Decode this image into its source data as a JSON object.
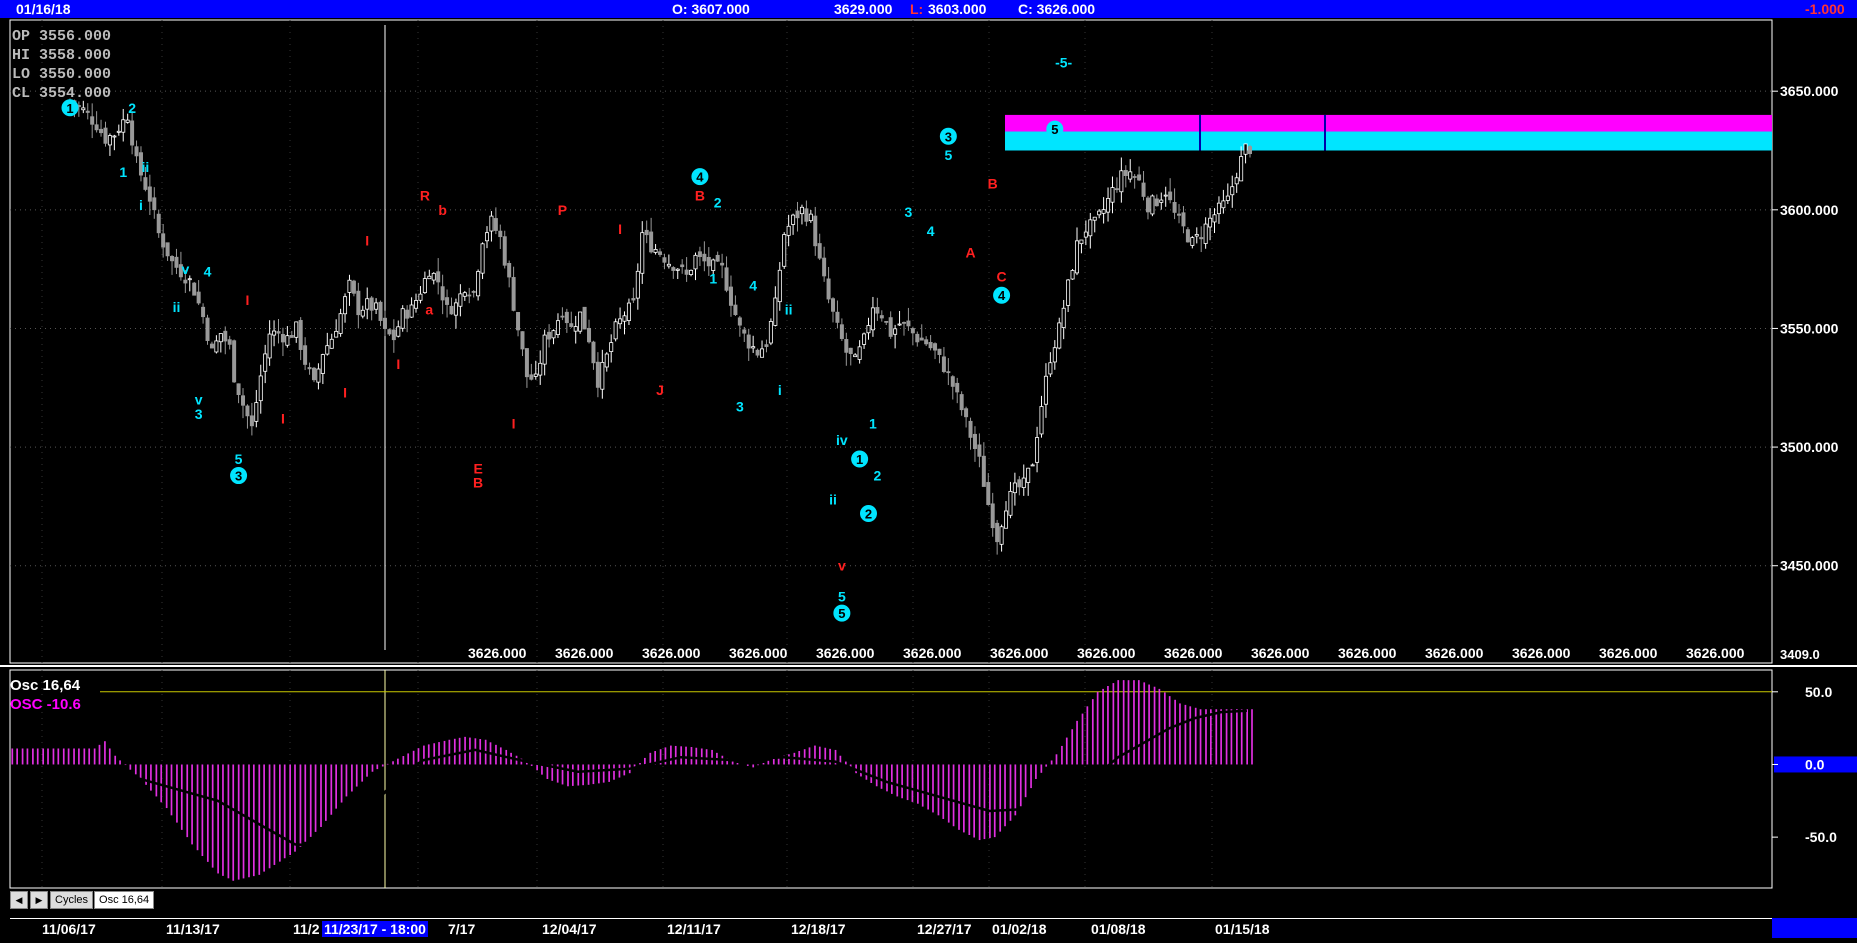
{
  "header": {
    "date": "01/16/18",
    "open": "O: 3607.000",
    "high": "3629.000",
    "low": "L: 3603.000",
    "close": "C: 3626.000",
    "change": "-1.000"
  },
  "info_panel": {
    "op": "OP  3556.000",
    "hi": "HI   3558.000",
    "lo": "LO  3550.000",
    "cl": "CL  3554.000"
  },
  "osc_panel": {
    "title": "Osc 16,64",
    "value": "OSC -10.6"
  },
  "tabs": [
    "Cycles",
    "Osc 16,64"
  ],
  "colors": {
    "up_candle": "#ffffff",
    "down_candle": "#999999",
    "cyan": "#00e5ff",
    "red": "#ff2020",
    "magenta": "#ff00ff",
    "histogram": "#e030e0",
    "header_bg": "#0000ff"
  },
  "chart_data": [
    {
      "type": "candlestick",
      "y_axis_ticks": [
        "3650.000",
        "3600.000",
        "3550.000",
        "3500.000",
        "3450.000"
      ],
      "y_axis_values": [
        3650,
        3600,
        3550,
        3500,
        3450
      ],
      "ylim": [
        3409,
        3680
      ],
      "axis_bottom_label": "3409.0",
      "price_line_labels": [
        "3626.000",
        "3626.000",
        "3626.000",
        "3626.000",
        "3626.000",
        "3626.000",
        "3626.000",
        "3626.000",
        "3626.000",
        "3626.000",
        "3626.000",
        "3626.000",
        "3626.000",
        "3626.000",
        "3626.000"
      ],
      "x_dates": [
        "11/06/17",
        "11/13/17",
        "11/2",
        "11/23/17 - 18:00",
        "7/17",
        "12/04/17",
        "12/11/17",
        "12/18/17",
        "12/27/17",
        "01/02/18",
        "01/08/18",
        "01/15/18"
      ],
      "close_path": [
        [
          0,
          3646
        ],
        [
          3,
          3642
        ],
        [
          6,
          3636
        ],
        [
          8,
          3630
        ],
        [
          10,
          3632
        ],
        [
          13,
          3640
        ],
        [
          15,
          3620
        ],
        [
          18,
          3605
        ],
        [
          20,
          3590
        ],
        [
          23,
          3578
        ],
        [
          25,
          3574
        ],
        [
          27,
          3570
        ],
        [
          28,
          3566
        ],
        [
          30,
          3555
        ],
        [
          32,
          3540
        ],
        [
          34,
          3548
        ],
        [
          36,
          3542
        ],
        [
          37,
          3530
        ],
        [
          39,
          3518
        ],
        [
          41,
          3508
        ],
        [
          43,
          3530
        ],
        [
          45,
          3548
        ],
        [
          47,
          3548
        ],
        [
          49,
          3546
        ],
        [
          51,
          3550
        ],
        [
          53,
          3536
        ],
        [
          55,
          3526
        ],
        [
          57,
          3540
        ],
        [
          59,
          3546
        ],
        [
          61,
          3556
        ],
        [
          63,
          3568
        ],
        [
          65,
          3558
        ],
        [
          67,
          3560
        ],
        [
          69,
          3558
        ],
        [
          71,
          3548
        ],
        [
          73,
          3546
        ],
        [
          75,
          3556
        ],
        [
          77,
          3558
        ],
        [
          79,
          3566
        ],
        [
          81,
          3575
        ],
        [
          83,
          3570
        ],
        [
          85,
          3558
        ],
        [
          87,
          3560
        ],
        [
          89,
          3568
        ],
        [
          91,
          3565
        ],
        [
          93,
          3588
        ],
        [
          95,
          3595
        ],
        [
          97,
          3588
        ],
        [
          99,
          3570
        ],
        [
          101,
          3550
        ],
        [
          103,
          3530
        ],
        [
          105,
          3528
        ],
        [
          107,
          3545
        ],
        [
          109,
          3550
        ],
        [
          111,
          3558
        ],
        [
          113,
          3550
        ],
        [
          115,
          3556
        ],
        [
          117,
          3546
        ],
        [
          119,
          3528
        ],
        [
          121,
          3538
        ],
        [
          123,
          3550
        ],
        [
          125,
          3556
        ],
        [
          127,
          3560
        ],
        [
          129,
          3590
        ],
        [
          131,
          3585
        ],
        [
          133,
          3582
        ],
        [
          135,
          3578
        ],
        [
          137,
          3576
        ],
        [
          139,
          3572
        ],
        [
          141,
          3580
        ],
        [
          143,
          3578
        ],
        [
          145,
          3576
        ],
        [
          147,
          3575
        ],
        [
          149,
          3562
        ],
        [
          151,
          3550
        ],
        [
          153,
          3544
        ],
        [
          155,
          3540
        ],
        [
          157,
          3544
        ],
        [
          159,
          3560
        ],
        [
          161,
          3590
        ],
        [
          163,
          3596
        ],
        [
          165,
          3600
        ],
        [
          167,
          3596
        ],
        [
          169,
          3578
        ],
        [
          171,
          3562
        ],
        [
          173,
          3550
        ],
        [
          175,
          3540
        ],
        [
          177,
          3536
        ],
        [
          179,
          3545
        ],
        [
          181,
          3560
        ],
        [
          183,
          3556
        ],
        [
          185,
          3548
        ],
        [
          187,
          3552
        ],
        [
          189,
          3550
        ],
        [
          191,
          3546
        ],
        [
          193,
          3544
        ],
        [
          195,
          3540
        ],
        [
          197,
          3534
        ],
        [
          199,
          3526
        ],
        [
          201,
          3516
        ],
        [
          203,
          3505
        ],
        [
          205,
          3494
        ],
        [
          207,
          3476
        ],
        [
          209,
          3462
        ],
        [
          211,
          3476
        ],
        [
          213,
          3482
        ],
        [
          215,
          3484
        ],
        [
          217,
          3494
        ],
        [
          219,
          3518
        ],
        [
          221,
          3538
        ],
        [
          223,
          3550
        ],
        [
          225,
          3568
        ],
        [
          227,
          3585
        ],
        [
          229,
          3592
        ],
        [
          231,
          3594
        ],
        [
          233,
          3600
        ],
        [
          235,
          3608
        ],
        [
          237,
          3614
        ],
        [
          239,
          3616
        ],
        [
          241,
          3612
        ],
        [
          243,
          3602
        ],
        [
          245,
          3604
        ],
        [
          247,
          3608
        ],
        [
          249,
          3598
        ],
        [
          251,
          3592
        ],
        [
          253,
          3586
        ],
        [
          255,
          3590
        ],
        [
          257,
          3596
        ],
        [
          259,
          3600
        ],
        [
          261,
          3604
        ],
        [
          263,
          3616
        ],
        [
          265,
          3626
        ]
      ],
      "bars": 267,
      "zones": [
        {
          "name": "magenta-zone",
          "y_low": 3633,
          "y_high": 3640,
          "color": "#ff00ff"
        },
        {
          "name": "cyan-zone",
          "y_low": 3625,
          "y_high": 3633,
          "color": "#00e5ff"
        }
      ],
      "annotations": [
        {
          "text": "1",
          "bar": 0,
          "price": 3643,
          "color": "cyan",
          "circled": true
        },
        {
          "text": "2",
          "bar": 14,
          "price": 3643,
          "color": "cyan"
        },
        {
          "text": "1",
          "bar": 12,
          "price": 3616,
          "color": "cyan"
        },
        {
          "text": "ii",
          "bar": 17,
          "price": 3618,
          "color": "cyan"
        },
        {
          "text": "i",
          "bar": 16,
          "price": 3602,
          "color": "cyan"
        },
        {
          "text": "v",
          "bar": 26,
          "price": 3575,
          "color": "cyan"
        },
        {
          "text": "4",
          "bar": 31,
          "price": 3574,
          "color": "cyan"
        },
        {
          "text": "ii",
          "bar": 24,
          "price": 3559,
          "color": "cyan"
        },
        {
          "text": "v",
          "bar": 29,
          "price": 3520,
          "color": "cyan"
        },
        {
          "text": "3",
          "bar": 29,
          "price": 3514,
          "color": "cyan"
        },
        {
          "text": "5",
          "bar": 38,
          "price": 3495,
          "color": "cyan"
        },
        {
          "text": "3",
          "bar": 38,
          "price": 3488,
          "color": "cyan",
          "circled": true
        },
        {
          "text": "I",
          "bar": 40,
          "price": 3562,
          "color": "red"
        },
        {
          "text": "I",
          "bar": 48,
          "price": 3512,
          "color": "red"
        },
        {
          "text": "I",
          "bar": 62,
          "price": 3523,
          "color": "red"
        },
        {
          "text": "I",
          "bar": 67,
          "price": 3587,
          "color": "red"
        },
        {
          "text": "I",
          "bar": 74,
          "price": 3535,
          "color": "red"
        },
        {
          "text": "R",
          "bar": 80,
          "price": 3606,
          "color": "red"
        },
        {
          "text": "b",
          "bar": 84,
          "price": 3600,
          "color": "red"
        },
        {
          "text": "a",
          "bar": 81,
          "price": 3558,
          "color": "red"
        },
        {
          "text": "E",
          "bar": 92,
          "price": 3491,
          "color": "red"
        },
        {
          "text": "B",
          "bar": 92,
          "price": 3485,
          "color": "red"
        },
        {
          "text": "I",
          "bar": 100,
          "price": 3510,
          "color": "red"
        },
        {
          "text": "P",
          "bar": 111,
          "price": 3600,
          "color": "red"
        },
        {
          "text": "I",
          "bar": 124,
          "price": 3592,
          "color": "red"
        },
        {
          "text": "J",
          "bar": 133,
          "price": 3524,
          "color": "red"
        },
        {
          "text": "4",
          "bar": 142,
          "price": 3614,
          "color": "cyan",
          "circled": true
        },
        {
          "text": "B",
          "bar": 142,
          "price": 3606,
          "color": "red"
        },
        {
          "text": "2",
          "bar": 146,
          "price": 3603,
          "color": "cyan"
        },
        {
          "text": "1",
          "bar": 145,
          "price": 3571,
          "color": "cyan"
        },
        {
          "text": "4",
          "bar": 154,
          "price": 3568,
          "color": "cyan"
        },
        {
          "text": "ii",
          "bar": 162,
          "price": 3558,
          "color": "cyan"
        },
        {
          "text": "i",
          "bar": 160,
          "price": 3524,
          "color": "cyan"
        },
        {
          "text": "3",
          "bar": 151,
          "price": 3517,
          "color": "cyan"
        },
        {
          "text": "iv",
          "bar": 174,
          "price": 3503,
          "color": "cyan"
        },
        {
          "text": "ii",
          "bar": 172,
          "price": 3478,
          "color": "cyan"
        },
        {
          "text": "v",
          "bar": 174,
          "price": 3450,
          "color": "red"
        },
        {
          "text": "5",
          "bar": 174,
          "price": 3437,
          "color": "cyan"
        },
        {
          "text": "5",
          "bar": 174,
          "price": 3430,
          "color": "cyan",
          "circled": true
        },
        {
          "text": "1",
          "bar": 181,
          "price": 3510,
          "color": "cyan"
        },
        {
          "text": "1",
          "bar": 178,
          "price": 3495,
          "color": "cyan",
          "circled": true
        },
        {
          "text": "2",
          "bar": 182,
          "price": 3488,
          "color": "cyan"
        },
        {
          "text": "2",
          "bar": 180,
          "price": 3472,
          "color": "cyan",
          "circled": true
        },
        {
          "text": "3",
          "bar": 189,
          "price": 3599,
          "color": "cyan"
        },
        {
          "text": "4",
          "bar": 194,
          "price": 3591,
          "color": "cyan"
        },
        {
          "text": "3",
          "bar": 198,
          "price": 3631,
          "color": "cyan",
          "circled": true
        },
        {
          "text": "5",
          "bar": 198,
          "price": 3623,
          "color": "cyan"
        },
        {
          "text": "B",
          "bar": 208,
          "price": 3611,
          "color": "red"
        },
        {
          "text": "A",
          "bar": 203,
          "price": 3582,
          "color": "red"
        },
        {
          "text": "C",
          "bar": 210,
          "price": 3572,
          "color": "red"
        },
        {
          "text": "4",
          "bar": 210,
          "price": 3564,
          "color": "cyan",
          "circled": true
        },
        {
          "text": "5",
          "bar": 222,
          "price": 3634,
          "color": "cyan",
          "circled": true
        },
        {
          "text": "-5-",
          "bar": 224,
          "price": 3662,
          "color": "cyan"
        }
      ]
    },
    {
      "type": "bar",
      "title": "Osc 16,64",
      "y_axis_ticks": [
        "50.0",
        "0.0",
        "-50.0"
      ],
      "y_axis_values": [
        50,
        0,
        -50
      ],
      "ylim": [
        -85,
        65
      ],
      "reference_line": 50,
      "histogram_path": [
        [
          0,
          11
        ],
        [
          16,
          11
        ],
        [
          18,
          16
        ],
        [
          20,
          6
        ],
        [
          25,
          -10
        ],
        [
          30,
          -30
        ],
        [
          35,
          -55
        ],
        [
          40,
          -75
        ],
        [
          43,
          -80
        ],
        [
          48,
          -76
        ],
        [
          55,
          -60
        ],
        [
          60,
          -43
        ],
        [
          65,
          -22
        ],
        [
          70,
          -5
        ],
        [
          75,
          4
        ],
        [
          80,
          13
        ],
        [
          85,
          17
        ],
        [
          88,
          19
        ],
        [
          92,
          17
        ],
        [
          96,
          10
        ],
        [
          100,
          2
        ],
        [
          104,
          -10
        ],
        [
          108,
          -15
        ],
        [
          112,
          -14
        ],
        [
          116,
          -12
        ],
        [
          120,
          -6
        ],
        [
          124,
          8
        ],
        [
          128,
          13
        ],
        [
          132,
          12
        ],
        [
          136,
          10
        ],
        [
          140,
          2
        ],
        [
          144,
          -2
        ],
        [
          148,
          4
        ],
        [
          152,
          8
        ],
        [
          156,
          13
        ],
        [
          160,
          10
        ],
        [
          164,
          -6
        ],
        [
          168,
          -15
        ],
        [
          172,
          -22
        ],
        [
          176,
          -27
        ],
        [
          180,
          -35
        ],
        [
          184,
          -45
        ],
        [
          188,
          -52
        ],
        [
          191,
          -50
        ],
        [
          195,
          -35
        ],
        [
          199,
          -10
        ],
        [
          203,
          7
        ],
        [
          207,
          30
        ],
        [
          211,
          50
        ],
        [
          215,
          58
        ],
        [
          219,
          58
        ],
        [
          223,
          52
        ],
        [
          227,
          42
        ],
        [
          231,
          38
        ],
        [
          235,
          38
        ],
        [
          239,
          38
        ],
        [
          241,
          38
        ]
      ],
      "signal_path": [
        [
          20,
          -5
        ],
        [
          30,
          -15
        ],
        [
          40,
          -25
        ],
        [
          50,
          -45
        ],
        [
          55,
          -55
        ],
        [
          60,
          -56
        ],
        [
          65,
          -50
        ],
        [
          70,
          -30
        ],
        [
          75,
          -8
        ],
        [
          80,
          3
        ],
        [
          90,
          10
        ],
        [
          100,
          2
        ],
        [
          110,
          -5
        ],
        [
          120,
          -3
        ],
        [
          130,
          5
        ],
        [
          140,
          3
        ],
        [
          150,
          5
        ],
        [
          160,
          2
        ],
        [
          170,
          -12
        ],
        [
          180,
          -22
        ],
        [
          190,
          -32
        ],
        [
          200,
          -30
        ],
        [
          210,
          -10
        ],
        [
          215,
          5
        ],
        [
          220,
          15
        ],
        [
          225,
          25
        ],
        [
          230,
          32
        ],
        [
          235,
          36
        ],
        [
          240,
          37
        ]
      ]
    }
  ]
}
